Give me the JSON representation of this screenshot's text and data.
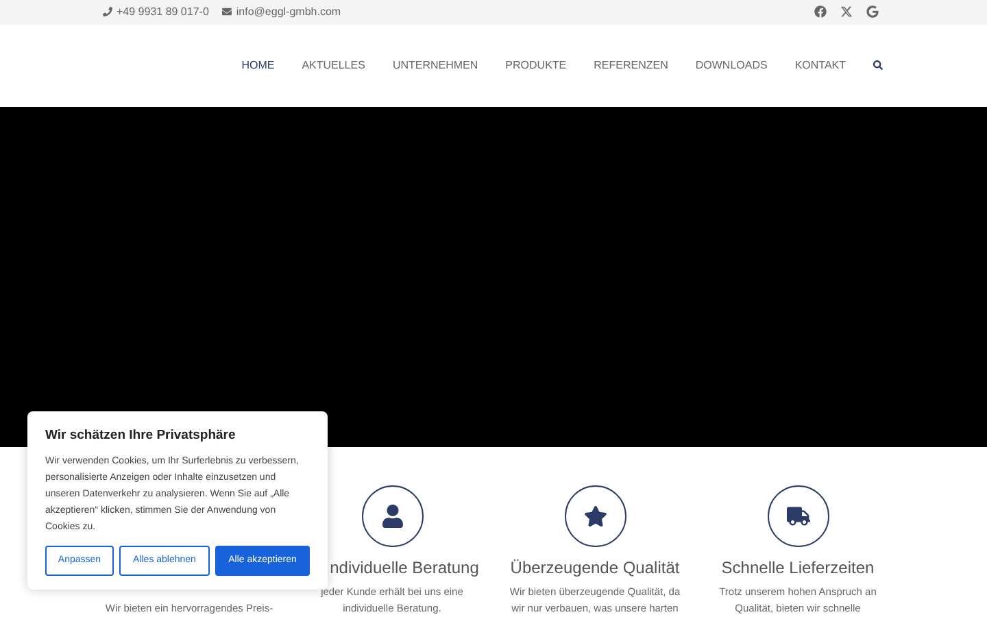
{
  "top_bar": {
    "phone": "+49 9931 89 017-0",
    "email": "info@eggl-gmbh.com"
  },
  "nav": [
    {
      "label": "HOME",
      "selected": true
    },
    {
      "label": "AKTUELLES",
      "selected": false
    },
    {
      "label": "UNTERNEHMEN",
      "selected": false
    },
    {
      "label": "PRODUKTE",
      "selected": false
    },
    {
      "label": "REFERENZEN",
      "selected": false
    },
    {
      "label": "DOWNLOADS",
      "selected": false
    },
    {
      "label": "KONTAKT",
      "selected": false
    }
  ],
  "features": [
    {
      "kind": "hidden",
      "description": "Wir bieten ein hervorragendes Preis-"
    },
    {
      "kind": "user",
      "title": "ndividuelle Beratung",
      "description": "jeder Kunde erhält bei uns eine individuelle Beratung."
    },
    {
      "kind": "star",
      "title": "Überzeugende Qualität",
      "description": "Wir bieten überzeugende Qualität, da wir nur verbauen, was unsere harten"
    },
    {
      "kind": "truck",
      "title": "Schnelle Lieferzeiten",
      "description": "Trotz unserem hohen Anspruch an Qualität, bieten wir schnelle"
    }
  ],
  "cookie_banner": {
    "title": "Wir schätzen Ihre Privatsphäre",
    "text": "Wir verwenden Cookies, um Ihr Surferlebnis zu verbessern, personalisierte Anzeigen oder Inhalte einzusetzen und unseren Datenverkehr zu analysieren. Wenn Sie auf „Alle akzeptieren“ klicken, stimmen Sie der Anwendung von Cookies zu.",
    "buttons": [
      {
        "label": "Anpassen",
        "kind": "outline"
      },
      {
        "label": "Alles ablehnen",
        "kind": "outline"
      },
      {
        "label": "Alle akzeptieren",
        "kind": "primary"
      }
    ]
  }
}
